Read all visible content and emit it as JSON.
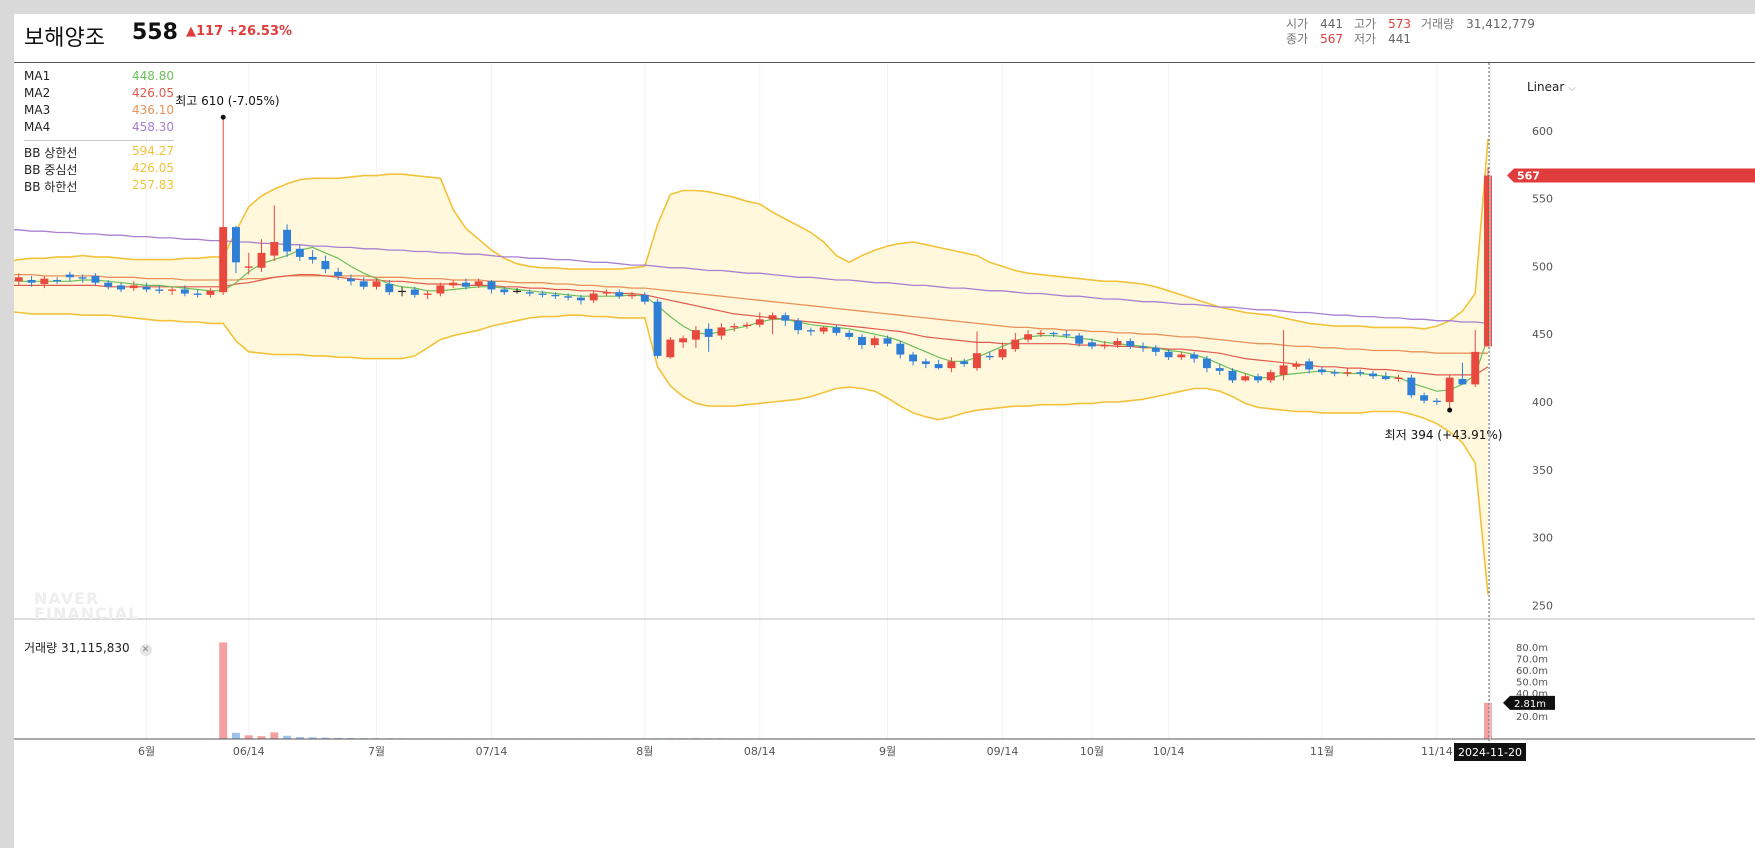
{
  "header": {
    "stock_name": "보해양조",
    "price": "558",
    "change": "▲117",
    "change_pct": "+26.53%",
    "open_label": "시가",
    "open": "441",
    "high_label": "고가",
    "high": "573",
    "volume_label": "거래량",
    "volume": "31,412,779",
    "close_label": "종가",
    "close": "567",
    "low_label": "저가",
    "low": "441"
  },
  "legend": {
    "ma": [
      {
        "name": "MA1",
        "value": "448.80",
        "color": "#6cbf5a"
      },
      {
        "name": "MA2",
        "value": "426.05",
        "color": "#e05a4e"
      },
      {
        "name": "MA3",
        "value": "436.10",
        "color": "#e8925a"
      },
      {
        "name": "MA4",
        "value": "458.30",
        "color": "#a97fd0"
      }
    ],
    "bb": [
      {
        "name": "BB 상한선",
        "value": "594.27",
        "color": "#f2c23a"
      },
      {
        "name": "BB 중심선",
        "value": "426.05",
        "color": "#f2c23a"
      },
      {
        "name": "BB 하한선",
        "value": "257.83",
        "color": "#f2c23a"
      }
    ]
  },
  "scale_mode": "Linear",
  "volume_panel": {
    "label": "거래량",
    "value": "31,115,830"
  },
  "watermark": [
    "NAVER",
    "FINANCIAL"
  ],
  "annotations": {
    "high_text": "최고 610 (-7.05%)",
    "low_text": "최저 394 (+43.91%)"
  },
  "current_price_tag": "567",
  "volume_tag": "2.81m",
  "date_tag": "2024-11-20",
  "colors": {
    "up": "#e8493e",
    "down": "#2f7fd6",
    "ma1": "#6cbf5a",
    "ma2": "#e05a4e",
    "ma3": "#e8925a",
    "ma4": "#a97fd0",
    "bb": "#f2c23a",
    "bbfill": "#fff8dc"
  },
  "chart_data": {
    "type": "candlestick",
    "y_ticks": [
      600,
      550,
      500,
      450,
      400,
      350,
      300,
      250
    ],
    "y_range": [
      240,
      650
    ],
    "vol_ticks": [
      "80.0m",
      "70.0m",
      "60.0m",
      "50.0m",
      "40.0m",
      "30.0m",
      "20.0m"
    ],
    "vol_range": [
      0,
      80
    ],
    "x_ticks": [
      {
        "label": "6월",
        "i": 11
      },
      {
        "label": "06/14",
        "i": 19
      },
      {
        "label": "7월",
        "i": 29
      },
      {
        "label": "07/14",
        "i": 38
      },
      {
        "label": "8월",
        "i": 50
      },
      {
        "label": "08/14",
        "i": 59
      },
      {
        "label": "9월",
        "i": 69
      },
      {
        "label": "09/14",
        "i": 78
      },
      {
        "label": "10월",
        "i": 85
      },
      {
        "label": "10/14",
        "i": 91
      },
      {
        "label": "11월",
        "i": 103
      },
      {
        "label": "11/14",
        "i": 112
      }
    ],
    "candles": [
      [
        491,
        486,
        494,
        484
      ],
      [
        489,
        492,
        495,
        486
      ],
      [
        490,
        488,
        493,
        485
      ],
      [
        487,
        491,
        493,
        484
      ],
      [
        490,
        489,
        492,
        487
      ],
      [
        494,
        492,
        496,
        489
      ],
      [
        492,
        491,
        494,
        488
      ],
      [
        493,
        488,
        495,
        486
      ],
      [
        488,
        485,
        490,
        483
      ],
      [
        486,
        483,
        488,
        481
      ],
      [
        484,
        486,
        489,
        482
      ],
      [
        485,
        483,
        488,
        481
      ],
      [
        483,
        482,
        486,
        480
      ],
      [
        482,
        483,
        485,
        479
      ],
      [
        483,
        480,
        486,
        478
      ],
      [
        480,
        479,
        483,
        477
      ],
      [
        479,
        482,
        484,
        477
      ],
      [
        481,
        529,
        610,
        479
      ],
      [
        529,
        503,
        530,
        495
      ],
      [
        499,
        500,
        510,
        494
      ],
      [
        499,
        510,
        520,
        496
      ],
      [
        508,
        518,
        545,
        504
      ],
      [
        527,
        511,
        531,
        507
      ],
      [
        513,
        507,
        516,
        504
      ],
      [
        507,
        505,
        512,
        502
      ],
      [
        504,
        498,
        508,
        495
      ],
      [
        496,
        493,
        499,
        490
      ],
      [
        491,
        489,
        494,
        486
      ],
      [
        489,
        485,
        492,
        483
      ],
      [
        485,
        489,
        491,
        483
      ],
      [
        487,
        481,
        490,
        479
      ],
      [
        482,
        482,
        485,
        478
      ],
      [
        483,
        479,
        485,
        477
      ],
      [
        479,
        480,
        482,
        476
      ],
      [
        480,
        486,
        488,
        478
      ],
      [
        486,
        488,
        490,
        484
      ],
      [
        488,
        485,
        491,
        483
      ],
      [
        486,
        489,
        491,
        484
      ],
      [
        489,
        483,
        490,
        480
      ],
      [
        483,
        481,
        485,
        479
      ],
      [
        482,
        482,
        484,
        480
      ],
      [
        481,
        480,
        483,
        478
      ],
      [
        480,
        479,
        482,
        477
      ],
      [
        479,
        478,
        481,
        476
      ],
      [
        478,
        477,
        480,
        475
      ],
      [
        477,
        475,
        479,
        472
      ],
      [
        475,
        480,
        482,
        473
      ],
      [
        480,
        481,
        483,
        478
      ],
      [
        481,
        478,
        483,
        476
      ],
      [
        478,
        479,
        481,
        476
      ],
      [
        479,
        474,
        481,
        472
      ],
      [
        474,
        434,
        476,
        432
      ],
      [
        433,
        446,
        448,
        432
      ],
      [
        444,
        447,
        449,
        440
      ],
      [
        446,
        453,
        456,
        440
      ],
      [
        454,
        448,
        458,
        437
      ],
      [
        449,
        455,
        458,
        446
      ],
      [
        455,
        456,
        458,
        452
      ],
      [
        456,
        457,
        459,
        454
      ],
      [
        457,
        461,
        466,
        455
      ],
      [
        461,
        464,
        466,
        450
      ],
      [
        464,
        460,
        466,
        456
      ],
      [
        460,
        453,
        462,
        450
      ],
      [
        453,
        452,
        455,
        449
      ],
      [
        452,
        455,
        456,
        450
      ],
      [
        455,
        451,
        457,
        449
      ],
      [
        451,
        448,
        453,
        446
      ],
      [
        448,
        442,
        450,
        439
      ],
      [
        442,
        447,
        449,
        440
      ],
      [
        447,
        443,
        449,
        441
      ],
      [
        443,
        435,
        445,
        432
      ],
      [
        435,
        430,
        437,
        427
      ],
      [
        430,
        428,
        432,
        425
      ],
      [
        428,
        425,
        431,
        424
      ],
      [
        425,
        430,
        433,
        422
      ],
      [
        430,
        428,
        432,
        426
      ],
      [
        425,
        436,
        452,
        423
      ],
      [
        434,
        433,
        437,
        431
      ],
      [
        433,
        439,
        444,
        431
      ],
      [
        439,
        446,
        451,
        437
      ],
      [
        446,
        450,
        453,
        444
      ],
      [
        450,
        451,
        453,
        448
      ],
      [
        451,
        450,
        452,
        448
      ],
      [
        450,
        449,
        453,
        447
      ],
      [
        449,
        443,
        451,
        441
      ],
      [
        444,
        441,
        447,
        439
      ],
      [
        441,
        442,
        445,
        439
      ],
      [
        442,
        445,
        447,
        440
      ],
      [
        445,
        441,
        447,
        439
      ],
      [
        441,
        440,
        444,
        437
      ],
      [
        440,
        437,
        442,
        434
      ],
      [
        437,
        433,
        439,
        431
      ],
      [
        433,
        435,
        437,
        431
      ],
      [
        435,
        432,
        437,
        429
      ],
      [
        432,
        425,
        434,
        422
      ],
      [
        425,
        423,
        428,
        420
      ],
      [
        423,
        416,
        425,
        414
      ],
      [
        416,
        419,
        421,
        415
      ],
      [
        419,
        416,
        421,
        414
      ],
      [
        416,
        422,
        424,
        414
      ],
      [
        420,
        427,
        453,
        416
      ],
      [
        426,
        428,
        430,
        424
      ],
      [
        430,
        424,
        432,
        421
      ],
      [
        424,
        422,
        426,
        420
      ],
      [
        422,
        421,
        424,
        419
      ],
      [
        421,
        422,
        425,
        419
      ],
      [
        422,
        421,
        424,
        419
      ],
      [
        421,
        419,
        423,
        417
      ],
      [
        419,
        417,
        422,
        416
      ],
      [
        417,
        418,
        420,
        415
      ],
      [
        418,
        405,
        420,
        403
      ],
      [
        405,
        401,
        407,
        399
      ],
      [
        401,
        400,
        403,
        398
      ],
      [
        400,
        418,
        420,
        394
      ],
      [
        417,
        413,
        429,
        413
      ],
      [
        413,
        437,
        453,
        411
      ],
      [
        441,
        567,
        573,
        441
      ]
    ],
    "ma1": [
      490,
      489,
      489,
      489,
      489,
      489,
      490,
      490,
      489,
      488,
      487,
      486,
      486,
      485,
      484,
      483,
      482,
      482,
      488,
      496,
      502,
      505,
      508,
      512,
      514,
      510,
      506,
      500,
      495,
      491,
      487,
      485,
      484,
      482,
      482,
      483,
      484,
      485,
      485,
      484,
      483,
      482,
      481,
      480,
      479,
      478,
      478,
      478,
      478,
      479,
      478,
      471,
      463,
      456,
      451,
      450,
      452,
      454,
      456,
      459,
      461,
      461,
      459,
      457,
      456,
      455,
      454,
      452,
      450,
      448,
      445,
      441,
      437,
      433,
      430,
      430,
      433,
      437,
      441,
      445,
      448,
      449,
      449,
      448,
      447,
      446,
      444,
      443,
      442,
      441,
      440,
      438,
      437,
      435,
      432,
      428,
      424,
      421,
      418,
      418,
      420,
      421,
      422,
      423,
      422,
      421,
      421,
      420,
      419,
      418,
      414,
      411,
      408,
      409,
      413,
      420,
      448
    ],
    "ma2": [
      486,
      486,
      486,
      486,
      486,
      486,
      486,
      486,
      485,
      485,
      485,
      485,
      485,
      485,
      485,
      485,
      485,
      485,
      487,
      488,
      490,
      492,
      493,
      494,
      494,
      493,
      492,
      491,
      490,
      490,
      489,
      489,
      488,
      487,
      487,
      487,
      486,
      486,
      486,
      485,
      485,
      484,
      484,
      483,
      483,
      482,
      482,
      481,
      480,
      480,
      479,
      477,
      475,
      473,
      471,
      469,
      467,
      465,
      464,
      463,
      462,
      461,
      460,
      459,
      458,
      457,
      456,
      455,
      454,
      453,
      452,
      450,
      448,
      447,
      446,
      445,
      444,
      444,
      443,
      443,
      443,
      443,
      443,
      443,
      442,
      442,
      442,
      441,
      441,
      440,
      440,
      439,
      439,
      438,
      437,
      436,
      434,
      432,
      431,
      430,
      429,
      428,
      427,
      426,
      426,
      425,
      425,
      424,
      424,
      423,
      422,
      421,
      420,
      420,
      420,
      420,
      426
    ],
    "ma3": [
      494,
      494,
      494,
      493,
      493,
      493,
      493,
      493,
      492,
      492,
      492,
      491,
      491,
      491,
      490,
      490,
      490,
      490,
      490,
      491,
      491,
      492,
      493,
      493,
      493,
      493,
      493,
      493,
      493,
      492,
      492,
      492,
      491,
      491,
      491,
      490,
      490,
      490,
      489,
      489,
      488,
      488,
      488,
      487,
      487,
      486,
      486,
      485,
      485,
      484,
      484,
      483,
      482,
      481,
      480,
      479,
      478,
      477,
      476,
      475,
      474,
      473,
      472,
      471,
      470,
      469,
      468,
      467,
      466,
      465,
      464,
      463,
      462,
      461,
      460,
      459,
      458,
      457,
      456,
      455,
      455,
      454,
      454,
      453,
      453,
      452,
      452,
      451,
      451,
      450,
      450,
      449,
      448,
      448,
      447,
      446,
      445,
      444,
      443,
      443,
      442,
      441,
      441,
      440,
      440,
      439,
      439,
      438,
      438,
      438,
      437,
      437,
      436,
      436,
      436,
      436,
      436
    ],
    "ma4": [
      527,
      527,
      526,
      526,
      525,
      525,
      524,
      524,
      523,
      523,
      522,
      522,
      521,
      521,
      520,
      520,
      519,
      519,
      518,
      518,
      517,
      517,
      516,
      516,
      515,
      515,
      514,
      514,
      513,
      513,
      512,
      512,
      511,
      511,
      510,
      510,
      509,
      509,
      508,
      507,
      507,
      506,
      506,
      505,
      505,
      504,
      503,
      503,
      502,
      501,
      501,
      500,
      499,
      499,
      498,
      497,
      497,
      496,
      495,
      495,
      494,
      493,
      492,
      492,
      491,
      490,
      490,
      489,
      488,
      488,
      487,
      486,
      486,
      485,
      484,
      484,
      483,
      482,
      482,
      481,
      480,
      480,
      479,
      478,
      478,
      477,
      476,
      476,
      475,
      474,
      474,
      473,
      472,
      472,
      471,
      470,
      470,
      469,
      468,
      468,
      467,
      466,
      466,
      465,
      464,
      464,
      463,
      463,
      462,
      462,
      461,
      461,
      460,
      460,
      459,
      459,
      458
    ],
    "bb_upper": [
      503,
      505,
      506,
      506,
      507,
      507,
      508,
      507,
      507,
      506,
      505,
      505,
      505,
      505,
      506,
      506,
      507,
      507,
      526,
      544,
      552,
      557,
      561,
      564,
      565,
      565,
      565,
      566,
      567,
      567,
      568,
      568,
      567,
      566,
      565,
      542,
      528,
      520,
      512,
      506,
      502,
      500,
      499,
      499,
      498,
      498,
      498,
      498,
      498,
      499,
      500,
      531,
      553,
      556,
      556,
      555,
      553,
      551,
      548,
      546,
      540,
      535,
      530,
      525,
      518,
      508,
      503,
      508,
      512,
      515,
      517,
      518,
      516,
      514,
      512,
      510,
      508,
      503,
      500,
      497,
      495,
      494,
      493,
      492,
      491,
      490,
      489,
      489,
      488,
      487,
      485,
      482,
      479,
      476,
      473,
      470,
      468,
      466,
      465,
      464,
      462,
      460,
      458,
      457,
      456,
      456,
      456,
      455,
      455,
      455,
      455,
      454,
      456,
      460,
      467,
      480,
      594
    ],
    "bb_lower": [
      467,
      466,
      465,
      465,
      465,
      465,
      464,
      464,
      464,
      463,
      462,
      461,
      460,
      460,
      459,
      459,
      458,
      458,
      445,
      437,
      436,
      435,
      435,
      435,
      434,
      434,
      433,
      433,
      432,
      432,
      432,
      432,
      434,
      440,
      446,
      449,
      451,
      453,
      456,
      458,
      460,
      462,
      463,
      463,
      464,
      464,
      463,
      463,
      462,
      462,
      462,
      426,
      412,
      404,
      399,
      397,
      397,
      397,
      398,
      399,
      400,
      401,
      402,
      404,
      407,
      410,
      411,
      410,
      408,
      403,
      397,
      392,
      389,
      387,
      389,
      392,
      394,
      395,
      396,
      397,
      397,
      398,
      398,
      398,
      399,
      399,
      400,
      400,
      401,
      402,
      404,
      406,
      408,
      410,
      410,
      408,
      404,
      399,
      396,
      395,
      394,
      393,
      393,
      392,
      392,
      392,
      392,
      393,
      393,
      393,
      391,
      388,
      384,
      378,
      370,
      355,
      258
    ],
    "volume": [
      0.2,
      0.2,
      0.2,
      0.2,
      0.2,
      0.2,
      0.2,
      0.2,
      0.2,
      0.2,
      0.2,
      0.2,
      0.2,
      0.2,
      0.2,
      0.2,
      0.2,
      84,
      5.4,
      3.2,
      2.5,
      5.8,
      2.8,
      1.7,
      1.5,
      1.2,
      0.9,
      0.8,
      0.7,
      0.6,
      0.6,
      0.6,
      0.5,
      0.5,
      0.5,
      0.5,
      0.5,
      0.5,
      0.5,
      0.5,
      0.5,
      0.5,
      0.5,
      0.5,
      0.5,
      0.5,
      0.5,
      0.5,
      0.5,
      0.5,
      0.5,
      0.6,
      0.6,
      0.6,
      0.6,
      0.6,
      0.6,
      0.5,
      0.5,
      0.5,
      0.5,
      0.5,
      0.5,
      0.5,
      0.5,
      0.5,
      0.5,
      0.5,
      0.5,
      0.5,
      0.5,
      0.5,
      0.5,
      0.5,
      0.5,
      0.5,
      0.5,
      0.5,
      0.5,
      0.5,
      0.5,
      0.5,
      0.5,
      0.5,
      0.5,
      0.5,
      0.5,
      0.5,
      0.5,
      0.5,
      0.5,
      0.5,
      0.5,
      0.5,
      0.5,
      0.5,
      0.5,
      0.5,
      0.5,
      0.5,
      0.5,
      0.5,
      0.5,
      0.5,
      0.5,
      0.5,
      0.5,
      0.5,
      0.5,
      0.5,
      0.5,
      0.5,
      0.5,
      0.5,
      0.5,
      0.5,
      31.4
    ]
  }
}
